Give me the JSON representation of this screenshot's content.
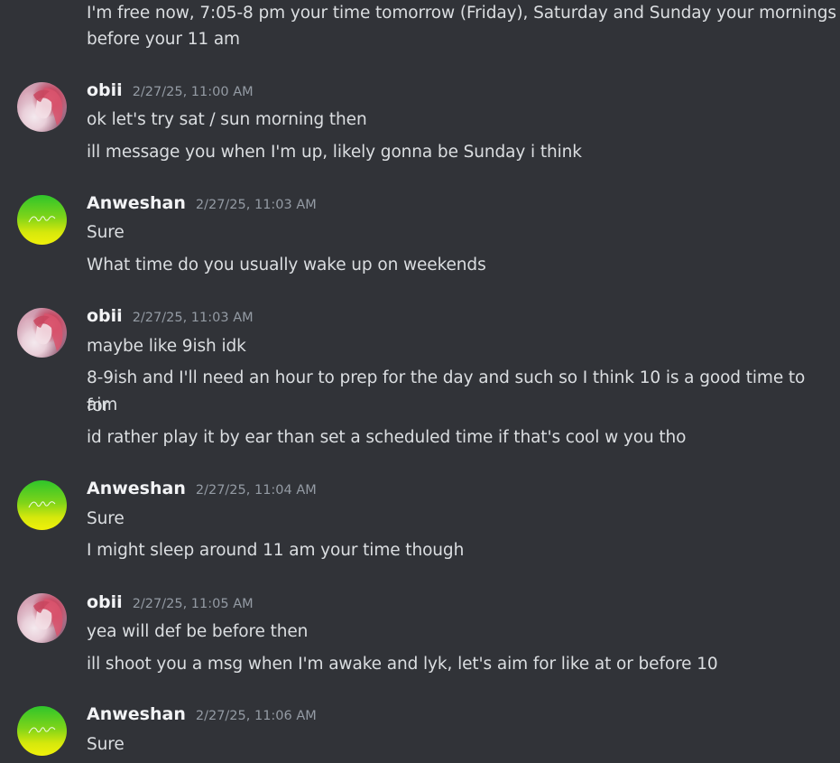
{
  "chat": {
    "top_message": {
      "line1": "I'm free now, 7:05-8 pm your time tomorrow (Friday), Saturday and Sunday your mornings",
      "line2": "before your 11 am"
    },
    "messages": [
      {
        "author": "obii",
        "timestamp": "2/27/25, 11:00 AM",
        "lines": [
          "ok let's try sat / sun morning then",
          "ill message you when I'm up, likely gonna be Sunday i think"
        ]
      },
      {
        "author": "Anweshan",
        "timestamp": "2/27/25, 11:03 AM",
        "lines": [
          "Sure",
          "What time do you usually wake up on weekends"
        ]
      },
      {
        "author": "obii",
        "timestamp": "2/27/25, 11:03 AM",
        "lines": [
          "maybe like 9ish idk",
          "8-9ish and I'll need an hour to prep for the day and such so I think 10 is a good time to aim",
          "for",
          "id rather play it by ear than set a scheduled time if that's cool w you tho"
        ]
      },
      {
        "author": "Anweshan",
        "timestamp": "2/27/25, 11:04 AM",
        "lines": [
          "Sure",
          "I might sleep around 11 am your time though"
        ]
      },
      {
        "author": "obii",
        "timestamp": "2/27/25, 11:05 AM",
        "lines": [
          "yea will def be before then",
          "ill shoot you a msg when I'm awake and lyk, let's aim for like at or before 10"
        ]
      },
      {
        "author": "Anweshan",
        "timestamp": "2/27/25, 11:06 AM",
        "lines": [
          "Sure"
        ]
      }
    ]
  },
  "theme": {
    "background": "#313338",
    "text": "#dbdee1",
    "author": "#f2f3f5",
    "timestamp": "#949ba4"
  },
  "avatars": {
    "obii": "anime-girl-pink-hair-avatar",
    "Anweshan": "green-yellow-signature-avatar"
  }
}
